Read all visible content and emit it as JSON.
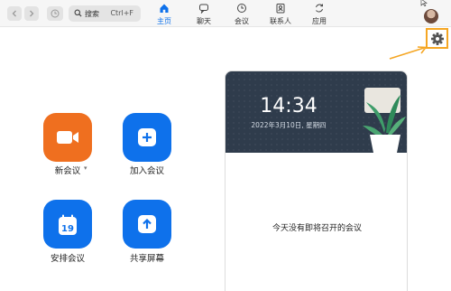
{
  "toolbar": {
    "back_icon": "chevron-left-icon",
    "forward_icon": "chevron-right-icon",
    "history_icon": "clock-icon",
    "search": {
      "label": "搜索",
      "shortcut": "Ctrl+F",
      "icon": "search-icon"
    }
  },
  "nav": {
    "tabs": [
      {
        "label": "主页",
        "icon": "home-icon",
        "active": true
      },
      {
        "label": "聊天",
        "icon": "chat-icon",
        "active": false
      },
      {
        "label": "会议",
        "icon": "clock-icon",
        "active": false
      },
      {
        "label": "联系人",
        "icon": "contacts-icon",
        "active": false
      },
      {
        "label": "应用",
        "icon": "apps-icon",
        "active": false
      }
    ]
  },
  "actions": [
    {
      "label": "新会议",
      "icon": "video-camera-icon",
      "color": "#ef6f1f",
      "has_dropdown": true
    },
    {
      "label": "加入会议",
      "icon": "plus-icon",
      "color": "#0e71eb"
    },
    {
      "label": "安排会议",
      "icon": "calendar-icon",
      "color": "#0e71eb",
      "calendar_day": "19"
    },
    {
      "label": "共享屏幕",
      "icon": "share-screen-icon",
      "color": "#0e71eb"
    }
  ],
  "card": {
    "time": "14:34",
    "date": "2022年3月10日, 星期四",
    "empty_message": "今天没有即将召开的会议"
  },
  "settings": {
    "icon": "gear-icon",
    "highlight_color": "#f5a623"
  },
  "colors": {
    "accent": "#0e71eb",
    "orange": "#ef6f1f",
    "banner": "#2f3c4c"
  }
}
